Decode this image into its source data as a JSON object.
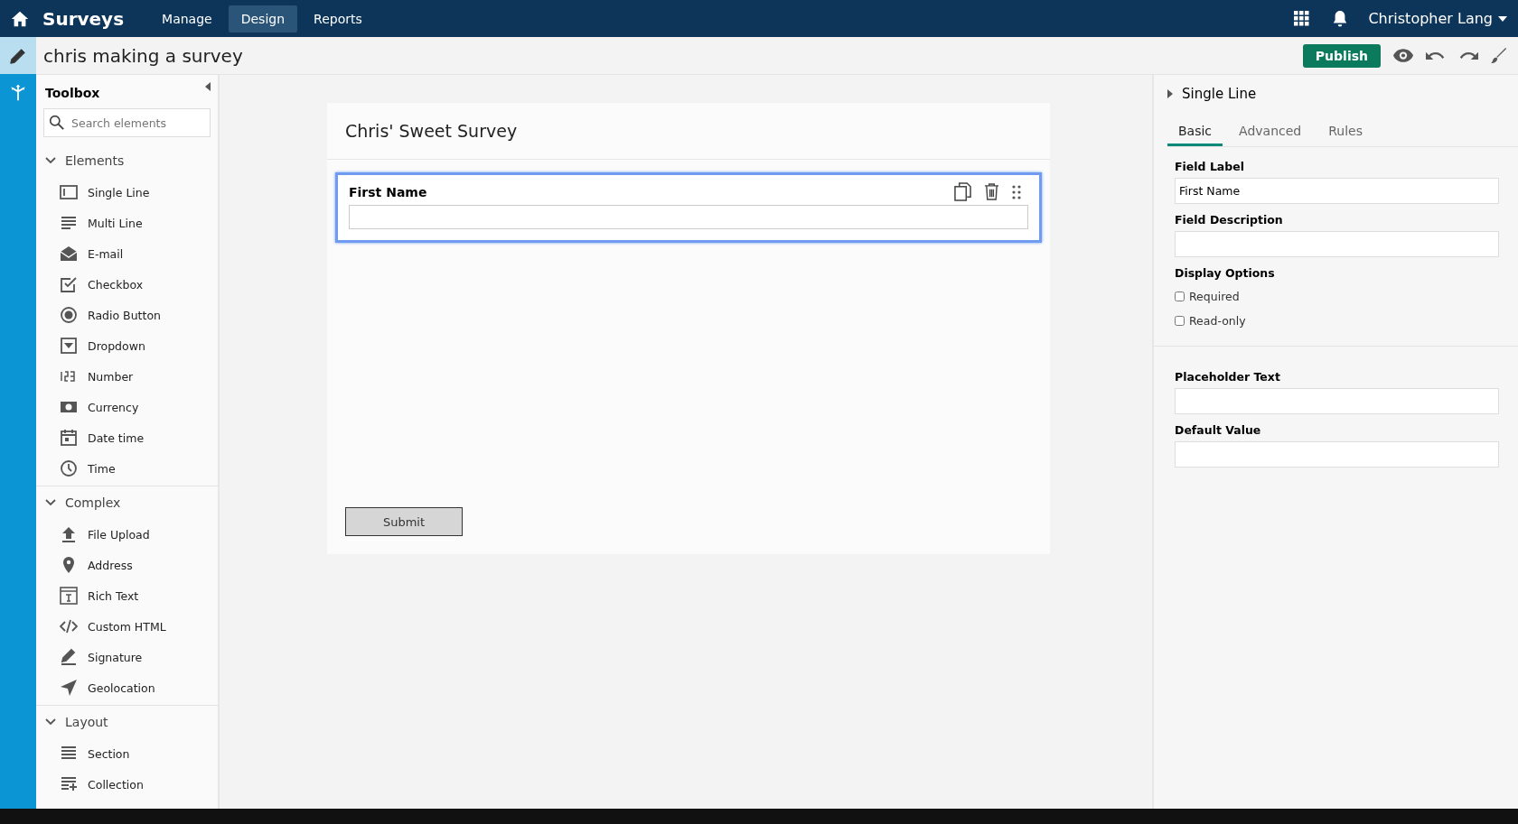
{
  "app_title": "Surveys",
  "nav": [
    {
      "label": "Manage",
      "selected": false
    },
    {
      "label": "Design",
      "selected": true
    },
    {
      "label": "Reports",
      "selected": false
    }
  ],
  "user": "Christopher Lang",
  "rail": [
    {
      "selected": true
    },
    {
      "selected": false
    }
  ],
  "survey_name": "chris making a survey",
  "publish": "Publish",
  "toolbox": {
    "title": "Toolbox",
    "search": {
      "placeholder": "Search elements"
    },
    "groups": [
      {
        "title": "Elements",
        "expanded": true,
        "items": [
          "Single Line",
          "Multi Line",
          "E-mail",
          "Checkbox",
          "Radio Button",
          "Dropdown",
          "Number",
          "Currency",
          "Date time",
          "Time"
        ]
      },
      {
        "title": "Complex",
        "expanded": true,
        "items": [
          "File Upload",
          "Address",
          "Rich Text",
          "Custom HTML",
          "Signature",
          "Geolocation"
        ]
      },
      {
        "title": "Layout",
        "expanded": true,
        "items": [
          "Section",
          "Collection"
        ]
      }
    ]
  },
  "form": {
    "title": "Chris' Sweet Survey",
    "fields": [
      {
        "label": "First Name",
        "selected": true
      }
    ],
    "submit": "Submit"
  },
  "properties": {
    "title": "Single Line",
    "tabs": [
      {
        "label": "Basic",
        "selected": true
      },
      {
        "label": "Advanced",
        "selected": false
      },
      {
        "label": "Rules",
        "selected": false
      }
    ],
    "field_label": {
      "label": "Field Label",
      "value": "First Name"
    },
    "field_description": {
      "label": "Field Description"
    },
    "display_options": {
      "label": "Display Options",
      "options": [
        {
          "label": "Required",
          "checked": false
        },
        {
          "label": "Read-only",
          "checked": false
        }
      ]
    },
    "placeholder_text": {
      "label": "Placeholder Text"
    },
    "default_value": {
      "label": "Default Value"
    }
  }
}
